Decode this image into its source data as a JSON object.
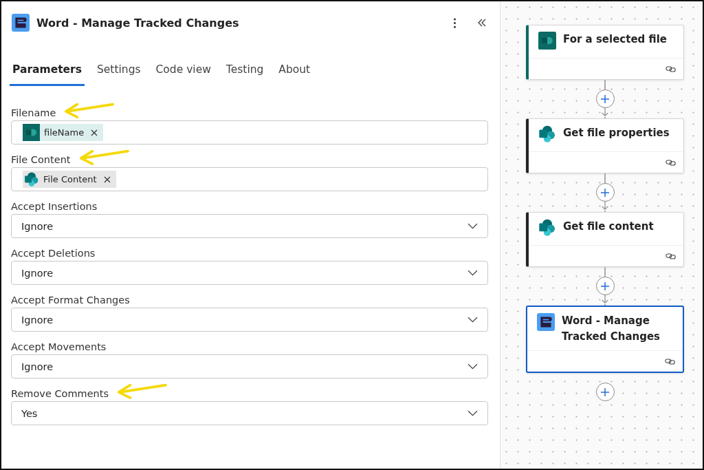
{
  "panel": {
    "title": "Word - Manage Tracked Changes"
  },
  "tabs": [
    {
      "label": "Parameters",
      "selected": true
    },
    {
      "label": "Settings",
      "selected": false
    },
    {
      "label": "Code view",
      "selected": false
    },
    {
      "label": "Testing",
      "selected": false
    },
    {
      "label": "About",
      "selected": false
    }
  ],
  "fields": [
    {
      "label": "Filename",
      "kind": "token",
      "annotated": true,
      "token": {
        "text": "fileName",
        "kind": "square"
      }
    },
    {
      "label": "File Content",
      "kind": "token",
      "annotated": true,
      "token": {
        "text": "File Content",
        "kind": "logo"
      }
    },
    {
      "label": "Accept Insertions",
      "kind": "dropdown",
      "annotated": false,
      "value": "Ignore"
    },
    {
      "label": "Accept Deletions",
      "kind": "dropdown",
      "annotated": false,
      "value": "Ignore"
    },
    {
      "label": "Accept Format Changes",
      "kind": "dropdown",
      "annotated": false,
      "value": "Ignore"
    },
    {
      "label": "Accept Movements",
      "kind": "dropdown",
      "annotated": false,
      "value": "Ignore"
    },
    {
      "label": "Remove Comments",
      "kind": "dropdown",
      "annotated": true,
      "value": "Yes"
    }
  ],
  "flow": [
    {
      "title": "For a selected file",
      "kind": "square",
      "color": "#0b6a63",
      "selected": false
    },
    {
      "title": "Get file properties",
      "kind": "logo",
      "color": "#242424",
      "selected": false
    },
    {
      "title": "Get file content",
      "kind": "logo",
      "color": "#242424",
      "selected": false
    },
    {
      "title": "Word - Manage Tracked Changes",
      "kind": "word",
      "selected": true
    }
  ]
}
